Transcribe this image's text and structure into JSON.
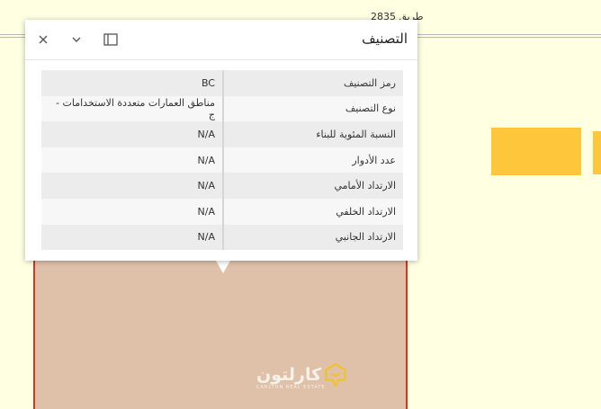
{
  "map": {
    "street_label": "طريق 2835",
    "watermark": {
      "brand_text": "كارلتون",
      "sub_text": "CARLTON REAL ESTATE"
    }
  },
  "popup": {
    "title": "التصنيف",
    "rows": [
      {
        "key": "رمز التصنيف",
        "value": "BC"
      },
      {
        "key": "نوع التصنيف",
        "value": "مناطق العمارات متعددة الاستخدامات - ج"
      },
      {
        "key": "النسبة المئوية للبناء",
        "value": "N/A"
      },
      {
        "key": "عدد الأدوار",
        "value": "N/A"
      },
      {
        "key": "الارتداد الأمامي",
        "value": "N/A"
      },
      {
        "key": "الارتداد الخلفي",
        "value": "N/A"
      },
      {
        "key": "الارتداد الجانبي",
        "value": "N/A"
      }
    ]
  },
  "colors": {
    "map_background": "#ffffe2",
    "parcel_fill": "#dfc1aa",
    "parcel_border": "#e0301e",
    "building_block": "#fdc63b"
  }
}
